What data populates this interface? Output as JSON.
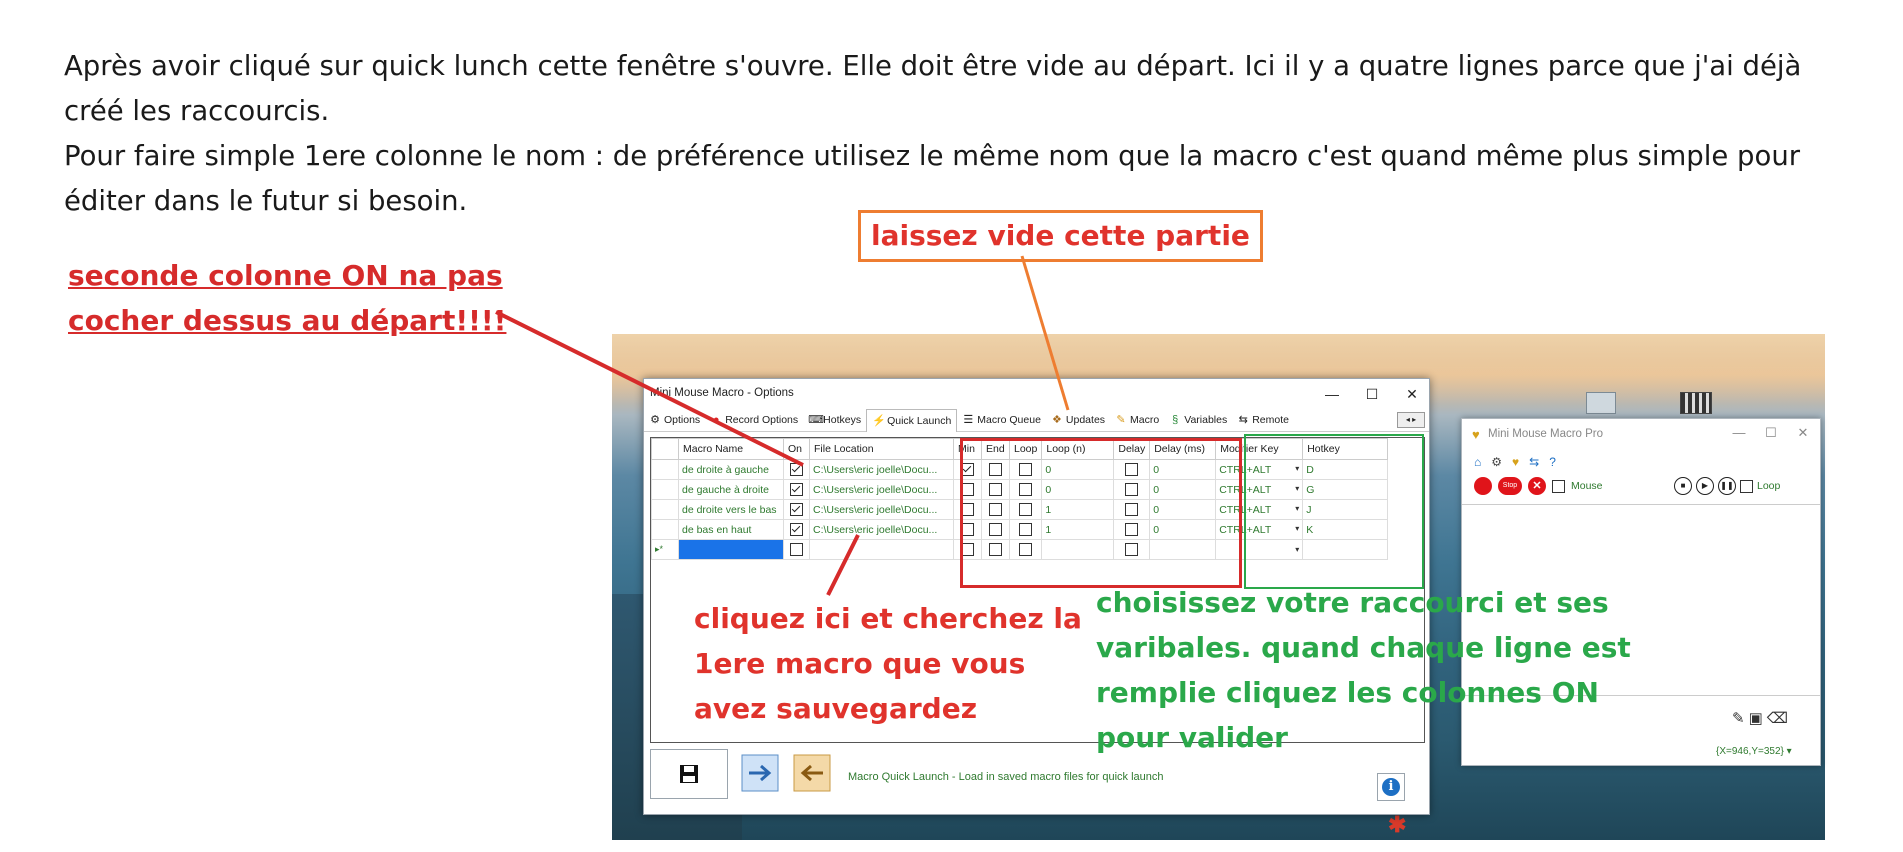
{
  "intro": {
    "p1": "Après avoir cliqué sur  quick lunch cette fenêtre s'ouvre. Elle doit être vide au départ. Ici il y a quatre lignes parce que j'ai déjà créé les raccourcis.",
    "p2": "Pour faire simple 1ere colonne le nom : de préférence utilisez le même nom que la macro c'est quand même plus simple pour éditer dans le futur si besoin."
  },
  "annotations": {
    "red_top_line1": "seconde colonne ON na pas",
    "red_top_line2": "cocher dessus au départ!!!!",
    "orange": "laissez vide  cette partie",
    "red_mid_line1": "cliquez ici et cherchez la",
    "red_mid_line2": "1ere macro que vous",
    "red_mid_line3": "avez sauvegardez",
    "green_line1": "choisissez votre raccourci et ses",
    "green_line2": "varibales. quand chaque ligne est",
    "green_line3": "remplie cliquez les colonnes ON",
    "green_line4": "pour valider"
  },
  "options_window": {
    "title": "Mini Mouse Macro - Options",
    "controls": {
      "minimize": "—",
      "maximize": "☐",
      "close": "✕"
    },
    "tabs": [
      {
        "label": "Options",
        "icon": "options-icon"
      },
      {
        "label": "Record Options",
        "icon": "record-options-icon"
      },
      {
        "label": "Hotkeys",
        "icon": "hotkeys-icon"
      },
      {
        "label": "Quick Launch",
        "icon": "lightning-icon",
        "active": true
      },
      {
        "label": "Macro Queue",
        "icon": "list-icon"
      },
      {
        "label": "Updates",
        "icon": "updates-icon"
      },
      {
        "label": "Macro",
        "icon": "pencil-icon"
      },
      {
        "label": "Variables",
        "icon": "variables-icon"
      },
      {
        "label": "Remote",
        "icon": "remote-icon"
      }
    ],
    "columns": [
      "Macro Name",
      "On",
      "File Location",
      "Min",
      "End",
      "Loop",
      "Loop (n)",
      "Delay",
      "Delay (ms)",
      "Modifier Key",
      "Hotkey"
    ],
    "rows": [
      {
        "name": "de droite à gauche",
        "on": true,
        "file": "C:\\Users\\eric joelle\\Docu...",
        "min": true,
        "end": false,
        "loop": false,
        "loop_n": "0",
        "delay": false,
        "delay_ms": "0",
        "modifier": "CTRL+ALT",
        "hotkey": "D"
      },
      {
        "name": "de gauche à droite",
        "on": true,
        "file": "C:\\Users\\eric joelle\\Docu...",
        "min": false,
        "end": false,
        "loop": false,
        "loop_n": "0",
        "delay": false,
        "delay_ms": "0",
        "modifier": "CTRL+ALT",
        "hotkey": "G"
      },
      {
        "name": "de droite vers le bas",
        "on": true,
        "file": "C:\\Users\\eric joelle\\Docu...",
        "min": false,
        "end": false,
        "loop": false,
        "loop_n": "1",
        "delay": false,
        "delay_ms": "0",
        "modifier": "CTRL+ALT",
        "hotkey": "J"
      },
      {
        "name": "de bas en haut",
        "on": true,
        "file": "C:\\Users\\eric joelle\\Docu...",
        "min": false,
        "end": false,
        "loop": false,
        "loop_n": "1",
        "delay": false,
        "delay_ms": "0",
        "modifier": "CTRL+ALT",
        "hotkey": "K"
      }
    ],
    "new_row_marker": "▸*",
    "status": "Macro Quick Launch - Load in saved macro files for quick launch",
    "info_label": "i"
  },
  "mini_window": {
    "title": "Mini Mouse Macro Pro",
    "stop_label": "Stop",
    "mouse_label": "Mouse",
    "loop_label": "Loop",
    "coords": "{X=946,Y=352}"
  },
  "colors": {
    "annotation_red": "#d62b2b",
    "annotation_orange": "#ee7d31",
    "annotation_green": "#2aa84a",
    "grid_text": "#2f7a2f"
  }
}
